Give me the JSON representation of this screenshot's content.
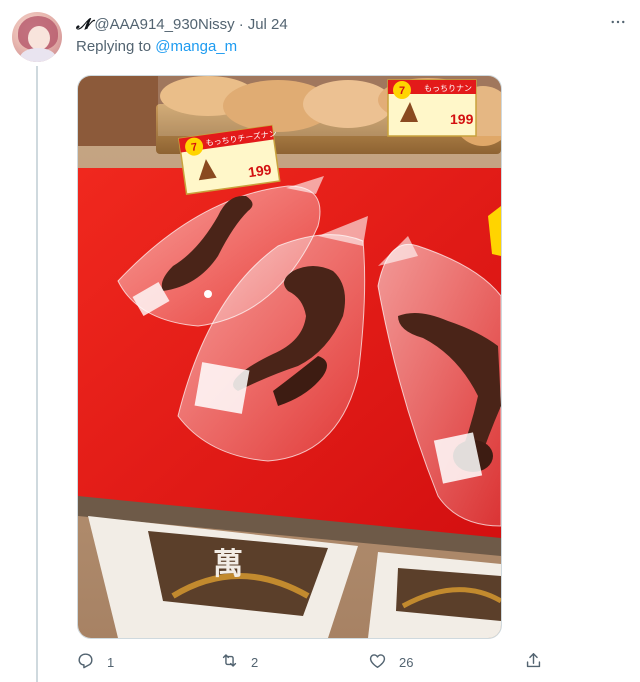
{
  "tweet": {
    "display_name": "𝓝",
    "handle": "@AAA914_930Nissy",
    "separator": "·",
    "date": "Jul 24",
    "replying_prefix": "Replying to",
    "replying_to": "@manga_m",
    "more_icon": "more-horizontal-icon",
    "avatar_icon": "avatar"
  },
  "media": {
    "sign_left_day": "7",
    "sign_left_title": "もっちりチーズナン",
    "sign_left_price": "199",
    "sign_right_day": "7",
    "sign_right_title": "もっちりナン",
    "sign_right_price": "199",
    "banner_text": "萬"
  },
  "actions": {
    "reply_count": "1",
    "retweet_count": "2",
    "like_count": "26",
    "reply_icon": "reply-icon",
    "retweet_icon": "retweet-icon",
    "like_icon": "heart-icon",
    "share_icon": "share-icon"
  },
  "colors": {
    "link": "#1d9bf0",
    "muted": "#536471",
    "text": "#0f1419",
    "table_red": "#e31717"
  }
}
